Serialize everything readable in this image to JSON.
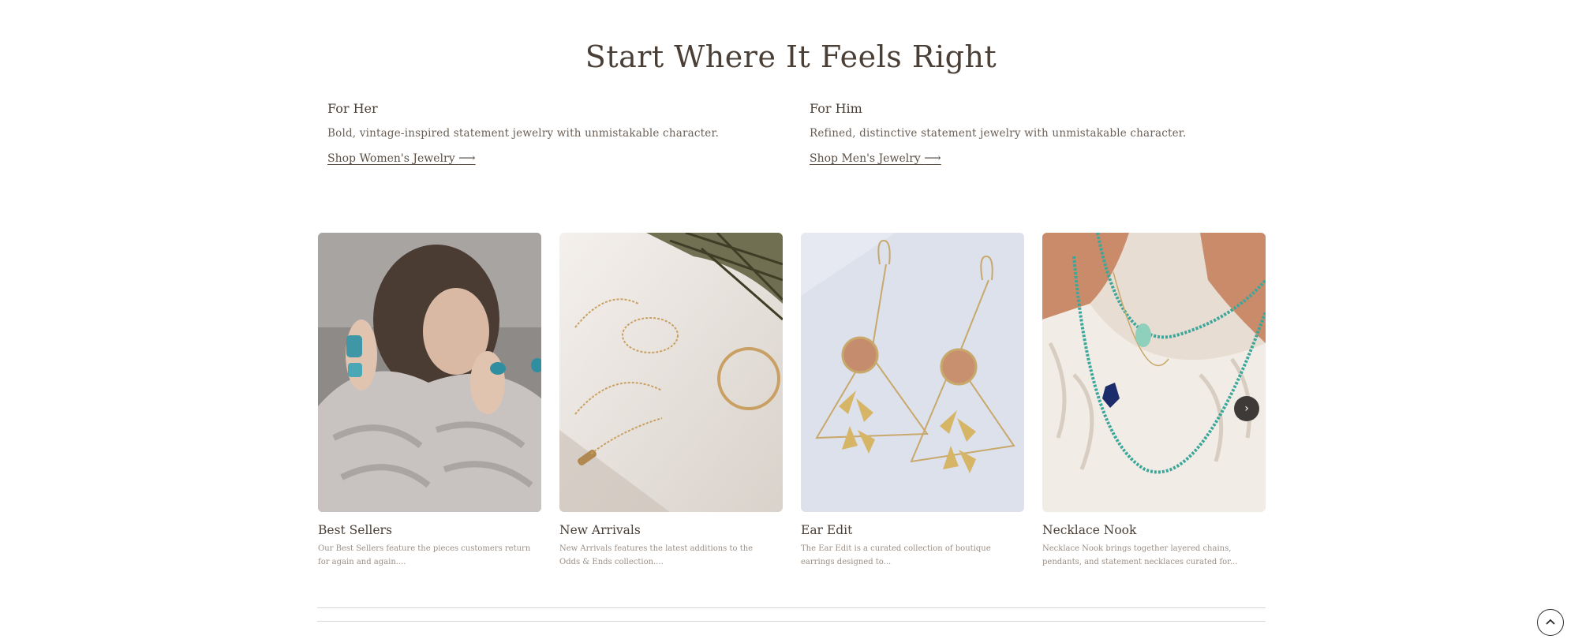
{
  "section": {
    "headline": "Start Where It Feels Right"
  },
  "intros": [
    {
      "title": "For Her",
      "description": "Bold, vintage-inspired statement jewelry with unmistakable character.",
      "link_label": "Shop Women's Jewelry",
      "link_arrow": "⟶"
    },
    {
      "title": "For Him",
      "description": "Refined, distinctive statement jewelry with unmistakable character.",
      "link_label": "Shop Men's Jewelry",
      "link_arrow": "⟶"
    }
  ],
  "collections": [
    {
      "name": "Best Sellers",
      "blurb": "Our Best Sellers feature the pieces customers return for again and again....",
      "image": "woman-in-sweater-with-turquoise-rings"
    },
    {
      "name": "New Arrivals",
      "blurb": "New Arrivals features the latest additions to the Odds & Ends collection....",
      "image": "gold-bracelets-with-palm-leaf"
    },
    {
      "name": "Ear Edit",
      "blurb": "The Ear Edit is a curated collection of boutique earrings designed to...",
      "image": "gold-triangle-leaf-earrings"
    },
    {
      "name": "Necklace Nook",
      "blurb": "Necklace Nook brings together layered chains, pendants, and statement necklaces curated for...",
      "image": "layered-turquoise-necklaces"
    }
  ],
  "controls": {
    "carousel_next_glyph": "›",
    "carousel_next_icon": "chevron-right-icon",
    "back_to_top_icon": "chevron-up-icon"
  },
  "colors": {
    "text_primary": "#4a3f36",
    "text_muted": "#9a8f86",
    "button_dark": "#3d3a37"
  }
}
